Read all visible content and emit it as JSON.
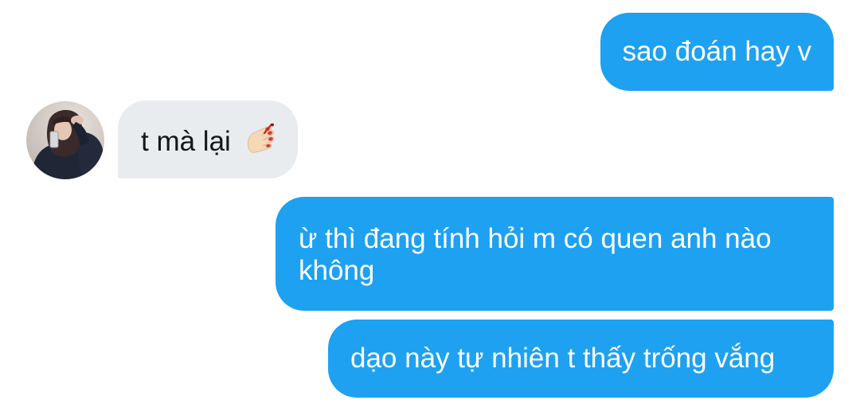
{
  "conversation": {
    "messages": [
      {
        "direction": "outgoing",
        "text": "sao đoán hay v"
      },
      {
        "direction": "incoming",
        "text": "t mà lại",
        "emoji": "nail-polish-emoji"
      },
      {
        "direction": "outgoing",
        "text": "ừ thì đang tính hỏi m có quen anh nào không"
      },
      {
        "direction": "outgoing",
        "text": "dạo này tự nhiên t thấy trống vắng"
      }
    ]
  },
  "colors": {
    "outgoing_bubble": "#1ea1f1",
    "incoming_bubble": "#e8ecef",
    "outgoing_text": "#ffffff",
    "incoming_text": "#141619"
  },
  "avatar": {
    "icon": "contact-avatar-photo"
  }
}
